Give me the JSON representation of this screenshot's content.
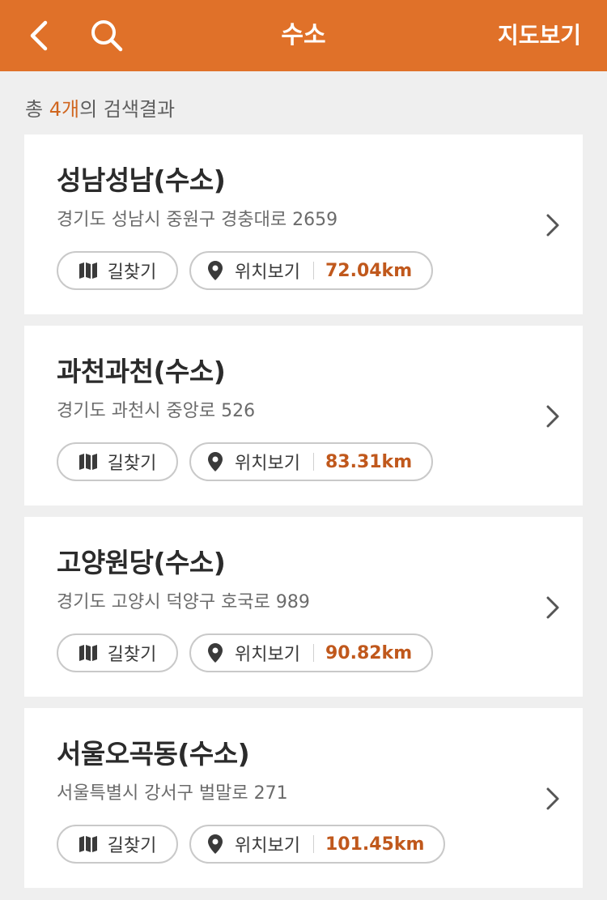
{
  "header": {
    "title": "수소",
    "map_view_label": "지도보기",
    "back_icon": "chevron-left-icon",
    "search_icon": "search-icon",
    "bg_color": "#e07129"
  },
  "summary": {
    "prefix": "총 ",
    "count": "4개",
    "suffix": "의 검색결과"
  },
  "buttons": {
    "route_label": "길찾기",
    "location_label": "위치보기"
  },
  "stations": [
    {
      "name": "성남성남(수소)",
      "address": "경기도 성남시 중원구 경충대로 2659",
      "distance": "72.04km"
    },
    {
      "name": "과천과천(수소)",
      "address": "경기도 과천시 중앙로 526",
      "distance": "83.31km"
    },
    {
      "name": "고양원당(수소)",
      "address": "경기도 고양시 덕양구 호국로 989",
      "distance": "90.82km"
    },
    {
      "name": "서울오곡동(수소)",
      "address": "서울특별시 강서구 벌말로 271",
      "distance": "101.45km"
    }
  ]
}
